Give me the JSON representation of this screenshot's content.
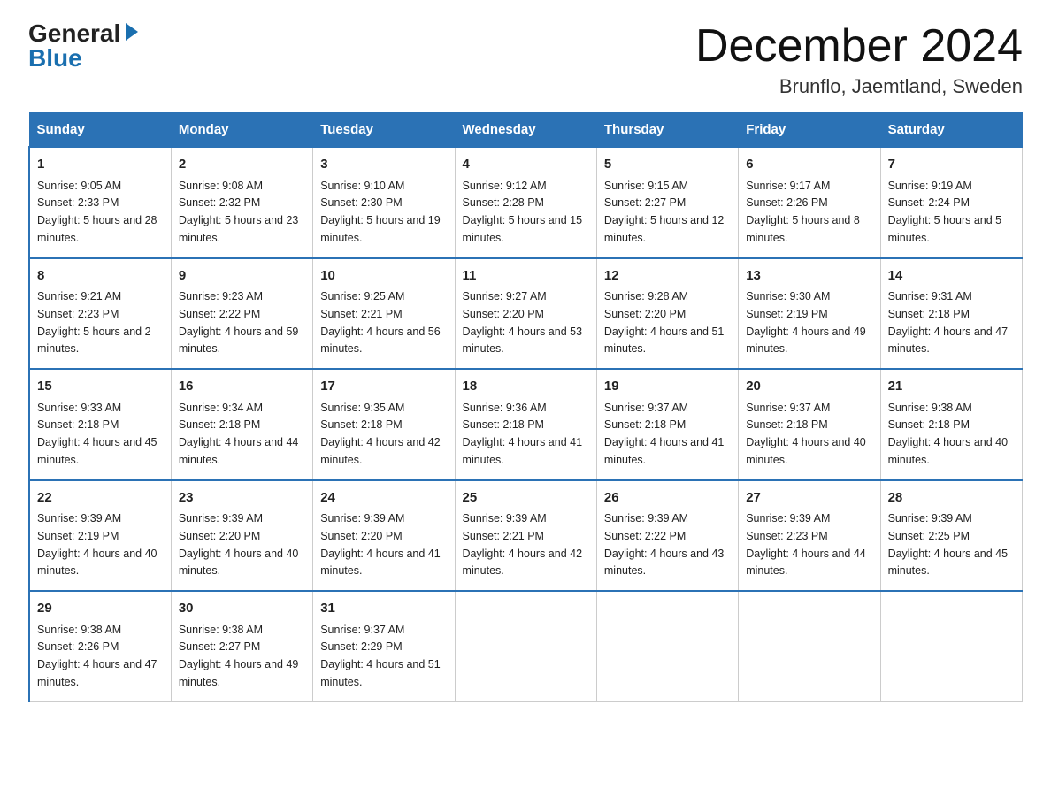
{
  "logo": {
    "general": "General",
    "blue": "Blue"
  },
  "title": "December 2024",
  "subtitle": "Brunflo, Jaemtland, Sweden",
  "days_of_week": [
    "Sunday",
    "Monday",
    "Tuesday",
    "Wednesday",
    "Thursday",
    "Friday",
    "Saturday"
  ],
  "weeks": [
    [
      {
        "day": "1",
        "sunrise": "9:05 AM",
        "sunset": "2:33 PM",
        "daylight": "5 hours and 28 minutes."
      },
      {
        "day": "2",
        "sunrise": "9:08 AM",
        "sunset": "2:32 PM",
        "daylight": "5 hours and 23 minutes."
      },
      {
        "day": "3",
        "sunrise": "9:10 AM",
        "sunset": "2:30 PM",
        "daylight": "5 hours and 19 minutes."
      },
      {
        "day": "4",
        "sunrise": "9:12 AM",
        "sunset": "2:28 PM",
        "daylight": "5 hours and 15 minutes."
      },
      {
        "day": "5",
        "sunrise": "9:15 AM",
        "sunset": "2:27 PM",
        "daylight": "5 hours and 12 minutes."
      },
      {
        "day": "6",
        "sunrise": "9:17 AM",
        "sunset": "2:26 PM",
        "daylight": "5 hours and 8 minutes."
      },
      {
        "day": "7",
        "sunrise": "9:19 AM",
        "sunset": "2:24 PM",
        "daylight": "5 hours and 5 minutes."
      }
    ],
    [
      {
        "day": "8",
        "sunrise": "9:21 AM",
        "sunset": "2:23 PM",
        "daylight": "5 hours and 2 minutes."
      },
      {
        "day": "9",
        "sunrise": "9:23 AM",
        "sunset": "2:22 PM",
        "daylight": "4 hours and 59 minutes."
      },
      {
        "day": "10",
        "sunrise": "9:25 AM",
        "sunset": "2:21 PM",
        "daylight": "4 hours and 56 minutes."
      },
      {
        "day": "11",
        "sunrise": "9:27 AM",
        "sunset": "2:20 PM",
        "daylight": "4 hours and 53 minutes."
      },
      {
        "day": "12",
        "sunrise": "9:28 AM",
        "sunset": "2:20 PM",
        "daylight": "4 hours and 51 minutes."
      },
      {
        "day": "13",
        "sunrise": "9:30 AM",
        "sunset": "2:19 PM",
        "daylight": "4 hours and 49 minutes."
      },
      {
        "day": "14",
        "sunrise": "9:31 AM",
        "sunset": "2:18 PM",
        "daylight": "4 hours and 47 minutes."
      }
    ],
    [
      {
        "day": "15",
        "sunrise": "9:33 AM",
        "sunset": "2:18 PM",
        "daylight": "4 hours and 45 minutes."
      },
      {
        "day": "16",
        "sunrise": "9:34 AM",
        "sunset": "2:18 PM",
        "daylight": "4 hours and 44 minutes."
      },
      {
        "day": "17",
        "sunrise": "9:35 AM",
        "sunset": "2:18 PM",
        "daylight": "4 hours and 42 minutes."
      },
      {
        "day": "18",
        "sunrise": "9:36 AM",
        "sunset": "2:18 PM",
        "daylight": "4 hours and 41 minutes."
      },
      {
        "day": "19",
        "sunrise": "9:37 AM",
        "sunset": "2:18 PM",
        "daylight": "4 hours and 41 minutes."
      },
      {
        "day": "20",
        "sunrise": "9:37 AM",
        "sunset": "2:18 PM",
        "daylight": "4 hours and 40 minutes."
      },
      {
        "day": "21",
        "sunrise": "9:38 AM",
        "sunset": "2:18 PM",
        "daylight": "4 hours and 40 minutes."
      }
    ],
    [
      {
        "day": "22",
        "sunrise": "9:39 AM",
        "sunset": "2:19 PM",
        "daylight": "4 hours and 40 minutes."
      },
      {
        "day": "23",
        "sunrise": "9:39 AM",
        "sunset": "2:20 PM",
        "daylight": "4 hours and 40 minutes."
      },
      {
        "day": "24",
        "sunrise": "9:39 AM",
        "sunset": "2:20 PM",
        "daylight": "4 hours and 41 minutes."
      },
      {
        "day": "25",
        "sunrise": "9:39 AM",
        "sunset": "2:21 PM",
        "daylight": "4 hours and 42 minutes."
      },
      {
        "day": "26",
        "sunrise": "9:39 AM",
        "sunset": "2:22 PM",
        "daylight": "4 hours and 43 minutes."
      },
      {
        "day": "27",
        "sunrise": "9:39 AM",
        "sunset": "2:23 PM",
        "daylight": "4 hours and 44 minutes."
      },
      {
        "day": "28",
        "sunrise": "9:39 AM",
        "sunset": "2:25 PM",
        "daylight": "4 hours and 45 minutes."
      }
    ],
    [
      {
        "day": "29",
        "sunrise": "9:38 AM",
        "sunset": "2:26 PM",
        "daylight": "4 hours and 47 minutes."
      },
      {
        "day": "30",
        "sunrise": "9:38 AM",
        "sunset": "2:27 PM",
        "daylight": "4 hours and 49 minutes."
      },
      {
        "day": "31",
        "sunrise": "9:37 AM",
        "sunset": "2:29 PM",
        "daylight": "4 hours and 51 minutes."
      },
      null,
      null,
      null,
      null
    ]
  ]
}
